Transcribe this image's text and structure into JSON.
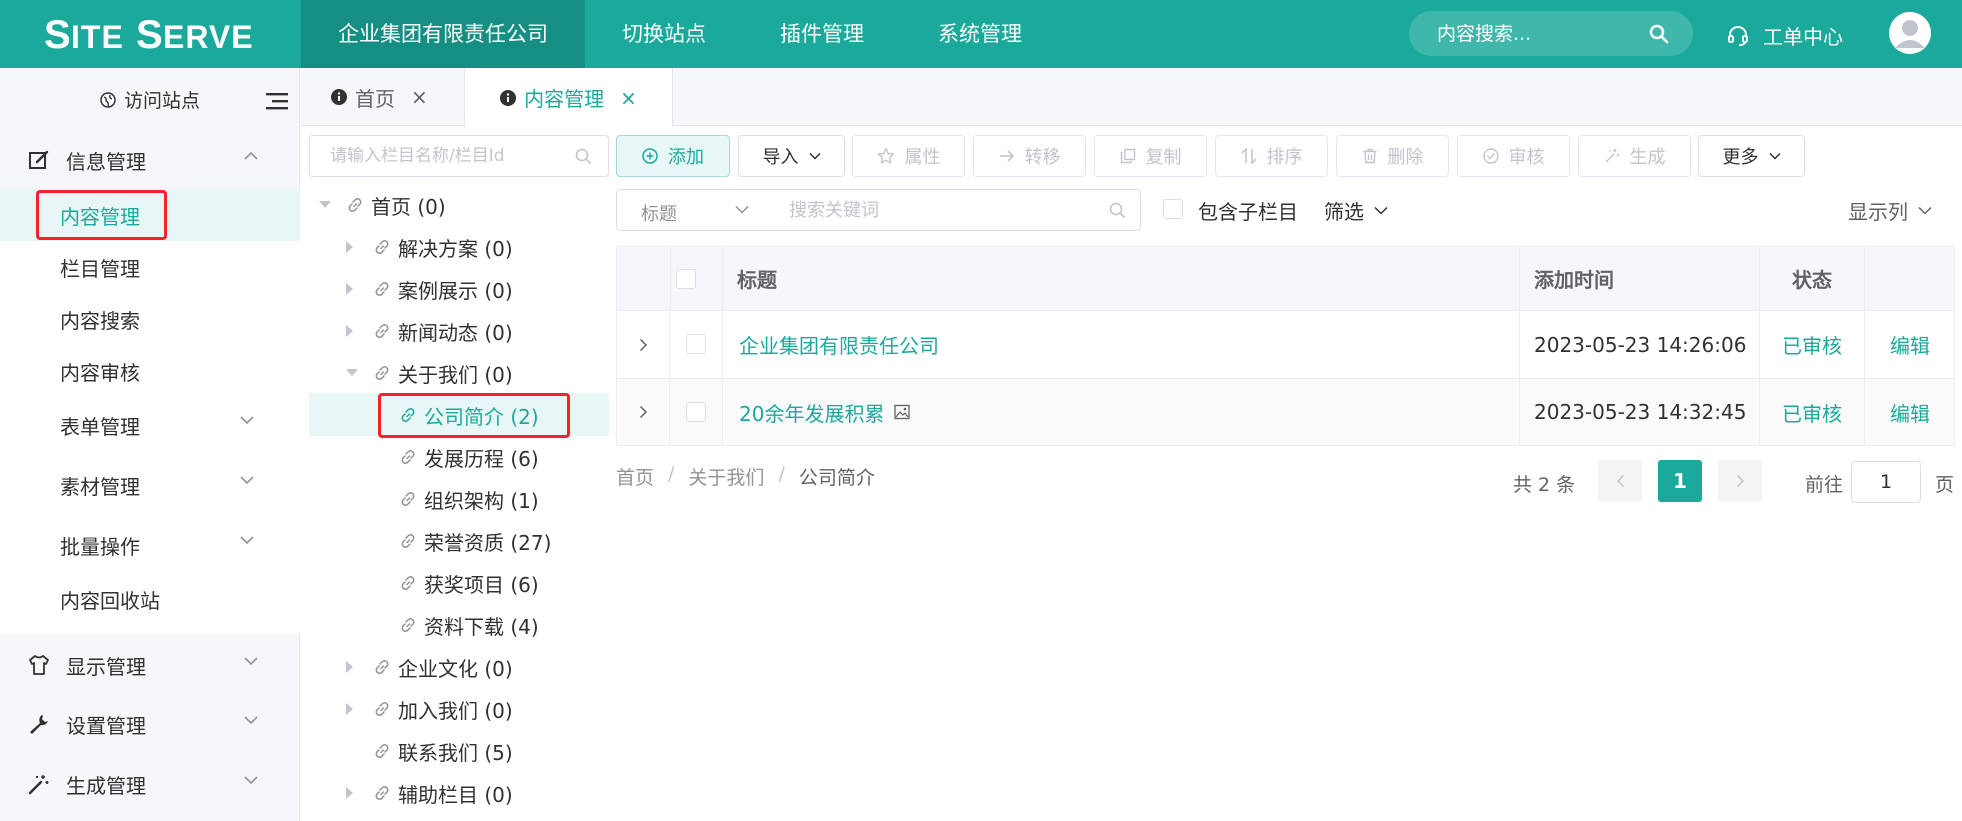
{
  "header": {
    "logo": "SITESERVER",
    "nav": [
      "企业集团有限责任公司",
      "切换站点",
      "插件管理",
      "系统管理"
    ],
    "search_placeholder": "内容搜索...",
    "ticket_label": "工单中心"
  },
  "sidebar": {
    "visit_label": "访问站点",
    "groups": [
      {
        "label": "信息管理",
        "icon": "edit-icon"
      },
      {
        "label": "显示管理",
        "icon": "shirt-icon"
      },
      {
        "label": "设置管理",
        "icon": "wrench-icon"
      },
      {
        "label": "生成管理",
        "icon": "magic-wand-icon"
      }
    ],
    "submenu": [
      "内容管理",
      "栏目管理",
      "内容搜索",
      "内容审核",
      "表单管理",
      "素材管理",
      "批量操作",
      "内容回收站"
    ]
  },
  "tabs": [
    {
      "label": "首页",
      "active": false
    },
    {
      "label": "内容管理",
      "active": true
    }
  ],
  "tree": {
    "search_placeholder": "请输入栏目名称/栏目Id",
    "nodes": [
      "首页 (0)",
      "解决方案 (0)",
      "案例展示 (0)",
      "新闻动态 (0)",
      "关于我们 (0)",
      "公司简介 (2)",
      "发展历程 (6)",
      "组织架构 (1)",
      "荣誉资质 (27)",
      "获奖项目 (6)",
      "资料下载 (4)",
      "企业文化 (0)",
      "加入我们 (0)",
      "联系我们 (5)",
      "辅助栏目 (0)"
    ]
  },
  "toolbar": {
    "add": "添加",
    "import": "导入",
    "attr": "属性",
    "transfer": "转移",
    "copy": "复制",
    "sort": "排序",
    "delete": "删除",
    "audit": "审核",
    "generate": "生成",
    "more": "更多"
  },
  "filter": {
    "field": "标题",
    "keyword_placeholder": "搜索关键词",
    "include_children": "包含子栏目",
    "filter_label": "筛选",
    "columns_label": "显示列"
  },
  "table": {
    "headers": {
      "title": "标题",
      "time": "添加时间",
      "status": "状态"
    },
    "rows": [
      {
        "title": "企业集团有限责任公司",
        "time": "2023-05-23 14:26:06",
        "status": "已审核",
        "action": "编辑"
      },
      {
        "title": "20余年发展积累",
        "time": "2023-05-23 14:32:45",
        "status": "已审核",
        "action": "编辑"
      }
    ]
  },
  "breadcrumb": [
    "首页",
    "关于我们",
    "公司简介"
  ],
  "pagination": {
    "total": "共 2 条",
    "current": "1",
    "goto": "前往",
    "page_input": "1",
    "unit": "页"
  },
  "colors": {
    "accent": "#1aa99b",
    "highlight": "#f5222d"
  }
}
